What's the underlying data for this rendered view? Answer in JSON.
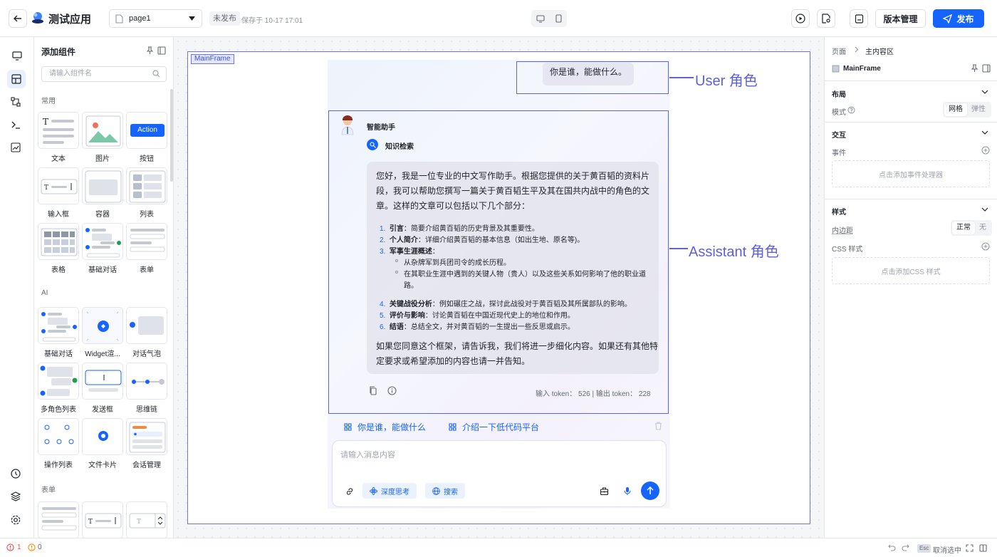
{
  "header": {
    "app_title": "测试应用",
    "page_select": "page1",
    "status_tag": "未发布",
    "save_time": "保存于 10-17 17:01",
    "version_button": "版本管理",
    "publish_button": "发布",
    "accent_color": "#1664ff"
  },
  "rail": {
    "icons": [
      "monitor-icon",
      "component-grid-icon",
      "flow-icon",
      "terminal-icon",
      "chart-icon",
      "history-icon",
      "layers-icon",
      "settings-icon"
    ]
  },
  "panel": {
    "title": "添加组件",
    "search_placeholder": "请输入组件名",
    "section_common": "常用",
    "section_ai": "AI",
    "section_form": "表单",
    "common": [
      "文本",
      "图片",
      "按钮",
      "输入框",
      "容器",
      "列表",
      "表格",
      "基础对话",
      "表单"
    ],
    "button_preview": "Action",
    "ai": [
      "基础对话",
      "Widget渲...",
      "对话气泡",
      "多角色列表",
      "发送框",
      "思维链",
      "操作列表",
      "文件卡片",
      "会话管理"
    ]
  },
  "canvas": {
    "frame_tag": "MainFrame",
    "user_message": "你是谁，能做什么。",
    "user_callout": "User 角色",
    "assistant_callout": "Assistant 角色",
    "bot_name": "智能助手",
    "knowledge_label": "知识检索",
    "answer": {
      "intro_1": "您好，我是一位专业的中文写作助手。根据您提供的关于黄百韬的资料片",
      "intro_2": "段，我可以帮助您撰写一篇关于黄百韬生平及其在国共内战中的角色的文",
      "intro_3": "章。这样的文章可以包括以下几个部分：",
      "items": [
        {
          "num": "1.",
          "title": "引言",
          "text": "：简要介绍黄百韬的历史背景及其重要性。"
        },
        {
          "num": "2.",
          "title": "个人简介",
          "text": "：详细介绍黄百韬的基本信息（如出生地、原名等)。"
        },
        {
          "num": "3.",
          "title": "军事生涯概述",
          "text": "："
        },
        {
          "num": "4.",
          "title": "关键战役分析",
          "text": "：例如碾庄之战，探讨此战役对于黄百韬及其所属部队的影响。"
        },
        {
          "num": "5.",
          "title": "评价与影响",
          "text": "：讨论黄百韬在中国近现代史上的地位和作用。"
        },
        {
          "num": "6.",
          "title": "结语",
          "text": "：总结全文，并对黄百韬的一生提出一些反思或启示。"
        }
      ],
      "sub_1": "从杂牌军到兵团司令的成长历程。",
      "sub_2a": "在其职业生涯中遇到的关键人物（贵人）以及这些关系如何影响了他的职业道",
      "sub_2b": "路。",
      "outro_1": "如果您同意这个框架，请告诉我，我们将进一步细化内容。如果还有其他特",
      "outro_2": "定要求或希望添加的内容也请一并告知。"
    },
    "token_text": "输入 token： 526  |  输出 token： 228",
    "suggestions": [
      "你是谁，能做什么",
      "介绍一下低代码平台"
    ],
    "input_placeholder": "请输入消息内容",
    "chip_deep": "深度思考",
    "chip_search": "搜索"
  },
  "right": {
    "breadcrumb_page": "页面",
    "breadcrumb_current": "主内容区",
    "component_name": "MainFrame",
    "layout_title": "布局",
    "mode_label": "模式",
    "mode_options": [
      "网格",
      "弹性"
    ],
    "interaction_title": "交互",
    "events_label": "事件",
    "add_event": "点击添加事件处理器",
    "style_title": "样式",
    "padding_label": "内边距",
    "padding_options": [
      "正常",
      "无"
    ],
    "css_label": "CSS 样式",
    "add_css": "点击添加CSS 样式"
  },
  "footer": {
    "error_count": "1",
    "warning_count": "0",
    "esc_key": "Esc",
    "deselect": "取消选中"
  }
}
